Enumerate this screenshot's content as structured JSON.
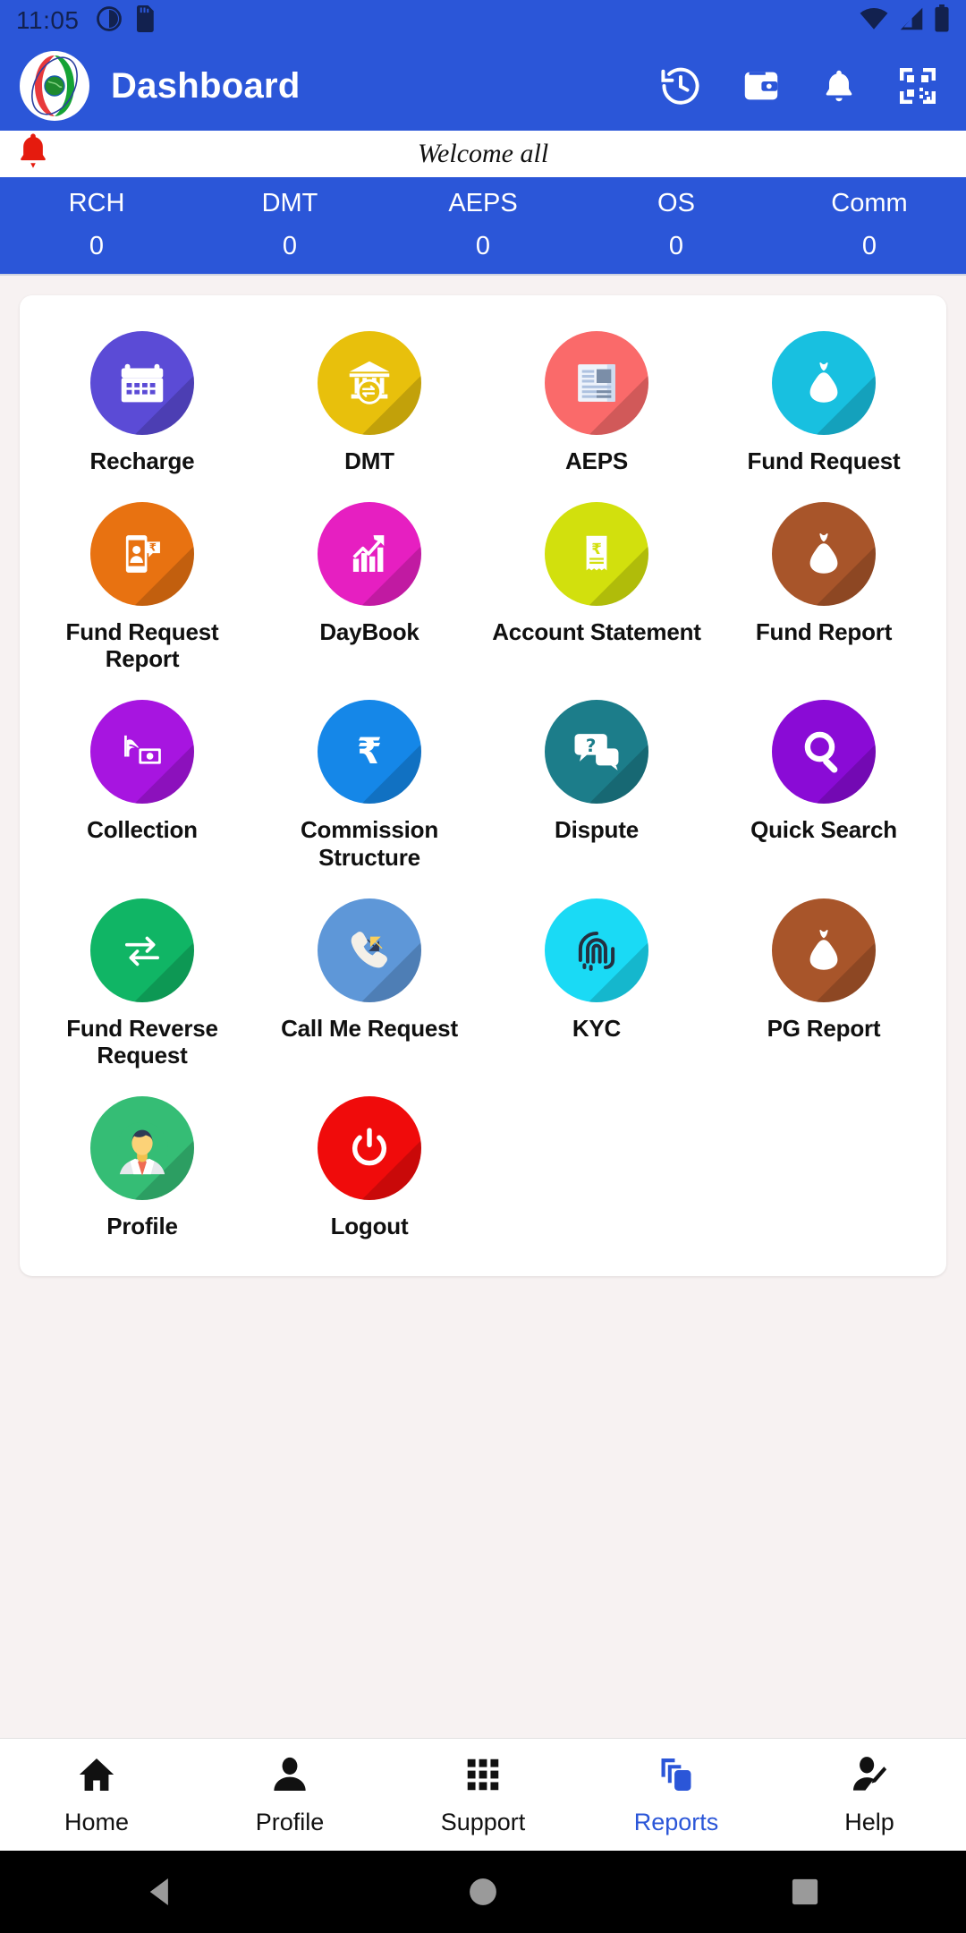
{
  "status_bar": {
    "time": "11:05",
    "left_icons": [
      "do-not-disturb-icon",
      "sd-card-icon"
    ],
    "right_icons": [
      "wifi-icon",
      "cellular-signal-icon",
      "battery-icon"
    ]
  },
  "app_bar": {
    "title": "Dashboard",
    "logo": "app-logo-globe",
    "actions": [
      {
        "name": "history-icon",
        "label": "History"
      },
      {
        "name": "wallet-icon",
        "label": "Wallet"
      },
      {
        "name": "notification-bell-icon",
        "label": "Notifications"
      },
      {
        "name": "qr-scan-icon",
        "label": "Scan QR"
      }
    ]
  },
  "welcome": {
    "bell_icon": "announcement-bell-icon",
    "message": "Welcome all"
  },
  "stats": [
    {
      "label": "RCH",
      "value": "0"
    },
    {
      "label": "DMT",
      "value": "0"
    },
    {
      "label": "AEPS",
      "value": "0"
    },
    {
      "label": "OS",
      "value": "0"
    },
    {
      "label": "Comm",
      "value": "0"
    }
  ],
  "menu": [
    {
      "label": "Recharge",
      "icon": "calendar-recharge-icon",
      "color": "#5B4BD6"
    },
    {
      "label": "DMT",
      "icon": "bank-transfer-icon",
      "color": "#E8C00C"
    },
    {
      "label": "AEPS",
      "icon": "document-report-icon",
      "color": "#FA6A6A"
    },
    {
      "label": "Fund Request",
      "icon": "money-bag-icon",
      "color": "#18C0E0"
    },
    {
      "label": "Fund Request Report",
      "icon": "mobile-rupee-request-icon",
      "color": "#E87211"
    },
    {
      "label": "DayBook",
      "icon": "bar-chart-growth-icon",
      "color": "#E61FC1"
    },
    {
      "label": "Account Statement",
      "icon": "rupee-receipt-icon",
      "color": "#D2E00D"
    },
    {
      "label": "Fund Report",
      "icon": "money-bag-icon",
      "color": "#A8552A"
    },
    {
      "label": "Collection",
      "icon": "hand-cash-icon",
      "color": "#A715E0"
    },
    {
      "label": "Commission Structure",
      "icon": "rupee-symbol-icon",
      "color": "#1587E8"
    },
    {
      "label": "Dispute",
      "icon": "question-chat-icon",
      "color": "#1C7D8A"
    },
    {
      "label": "Quick Search",
      "icon": "magnifier-search-icon",
      "color": "#8A0BD6"
    },
    {
      "label": "Fund Reverse Request",
      "icon": "two-way-arrows-icon",
      "color": "#10B565"
    },
    {
      "label": "Call Me Request",
      "icon": "phone-callback-icon",
      "color": "#5E97D8"
    },
    {
      "label": "KYC",
      "icon": "fingerprint-icon",
      "color": "#1ADAF5"
    },
    {
      "label": "PG Report",
      "icon": "money-bag-icon",
      "color": "#A8552A"
    },
    {
      "label": "Profile",
      "icon": "user-avatar-icon",
      "color": "#35BD75"
    },
    {
      "label": "Logout",
      "icon": "power-off-icon",
      "color": "#F00B0B"
    }
  ],
  "bottom_nav": {
    "active": "Reports",
    "items": [
      {
        "label": "Home",
        "icon": "home-icon"
      },
      {
        "label": "Profile",
        "icon": "person-icon"
      },
      {
        "label": "Support",
        "icon": "grid-dots-icon"
      },
      {
        "label": "Reports",
        "icon": "copy-pages-icon"
      },
      {
        "label": "Help",
        "icon": "person-edit-icon"
      }
    ]
  },
  "system_nav": {
    "items": [
      "back-triangle-icon",
      "home-circle-icon",
      "recents-square-icon"
    ]
  },
  "colors": {
    "brand_blue": "#2B56D8",
    "accent_blue": "#2B56D8",
    "page_bg": "#f7f2f2",
    "card_bg": "#ffffff"
  }
}
